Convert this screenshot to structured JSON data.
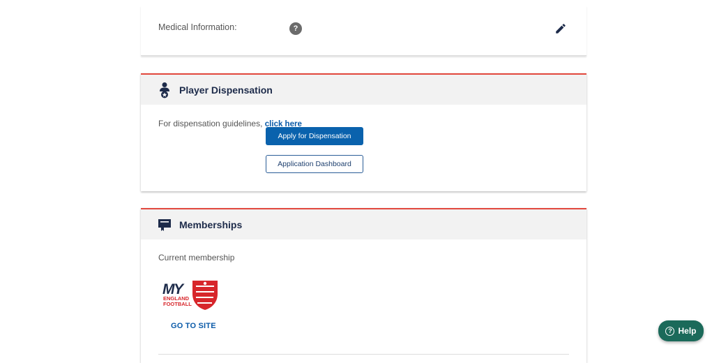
{
  "medical": {
    "label": "Medical Information:",
    "help_icon_text": "?",
    "edit_icon": "pencil-icon"
  },
  "dispensation": {
    "title": "Player Dispensation",
    "header_icon": "player-award-icon",
    "guidelines_text": "For dispensation guidelines,",
    "guidelines_link": "click here",
    "apply_button": "Apply for Dispensation",
    "dashboard_button": "Application Dashboard"
  },
  "memberships": {
    "title": "Memberships",
    "header_icon": "membership-card-icon",
    "current_label": "Current membership",
    "logo_lines": [
      "MY",
      "ENGLAND",
      "FOOTBALL"
    ],
    "goto_link": "GO TO SITE"
  },
  "help_widget": {
    "label": "Help",
    "icon_text": "?"
  },
  "colors": {
    "accent_red": "#e2483d",
    "primary_blue": "#0a62ad",
    "navy": "#1d2b4a",
    "help_green": "#1b6a5a"
  }
}
